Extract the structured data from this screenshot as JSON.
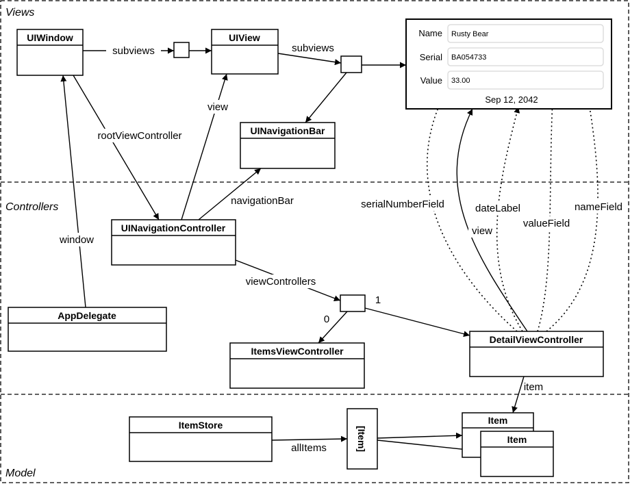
{
  "sections": {
    "views": "Views",
    "controllers": "Controllers",
    "model": "Model"
  },
  "classes": {
    "uiwindow": "UIWindow",
    "uiview": "UIView",
    "navbar": "UINavigationBar",
    "navcontroller": "UINavigationController",
    "appdelegate": "AppDelegate",
    "itemsvc": "ItemsViewController",
    "detailvc": "DetailViewController",
    "itemstore": "ItemStore",
    "item1": "Item",
    "item2": "Item",
    "itemarray": "[Item]"
  },
  "edges": {
    "subviews1": "subviews",
    "subviews2": "subviews",
    "rootViewController": "rootViewController",
    "window": "window",
    "view1": "view",
    "navigationBar": "navigationBar",
    "viewControllers": "viewControllers",
    "index0": "0",
    "index1": "1",
    "view2": "view",
    "serialNumberField": "serialNumberField",
    "dateLabel": "dateLabel",
    "valueField": "valueField",
    "nameField": "nameField",
    "item": "item",
    "allItems": "allItems"
  },
  "form": {
    "name_label": "Name",
    "name_value": "Rusty Bear",
    "serial_label": "Serial",
    "serial_value": "BA054733",
    "value_label": "Value",
    "value_value": "33.00",
    "date": "Sep 12, 2042"
  }
}
